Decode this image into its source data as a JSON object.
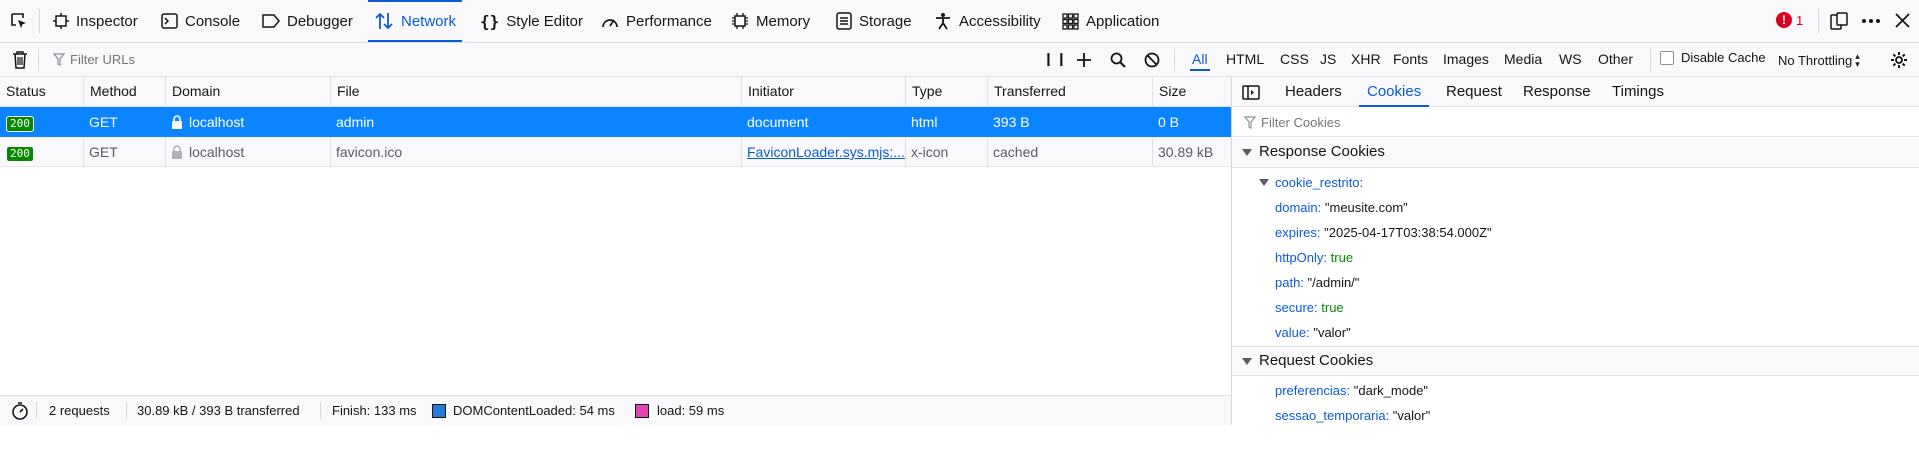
{
  "toolbar": {
    "tabs": [
      {
        "label": "Inspector",
        "icon": "inspector-icon"
      },
      {
        "label": "Console",
        "icon": "console-icon"
      },
      {
        "label": "Debugger",
        "icon": "debugger-icon"
      },
      {
        "label": "Network",
        "icon": "network-icon",
        "active": true
      },
      {
        "label": "Style Editor",
        "icon": "style-editor-icon"
      },
      {
        "label": "Performance",
        "icon": "performance-icon"
      },
      {
        "label": "Memory",
        "icon": "memory-icon"
      },
      {
        "label": "Storage",
        "icon": "storage-icon"
      },
      {
        "label": "Accessibility",
        "icon": "accessibility-icon"
      },
      {
        "label": "Application",
        "icon": "application-icon"
      }
    ],
    "error_count": "1",
    "colors": {
      "accent": "#0a5bd6",
      "error": "#d70022"
    }
  },
  "filterbar": {
    "placeholder": "Filter URLs",
    "types": [
      "All",
      "HTML",
      "CSS",
      "JS",
      "XHR",
      "Fonts",
      "Images",
      "Media",
      "WS",
      "Other"
    ],
    "active_type": "All",
    "disable_cache_label": "Disable Cache",
    "throttling": "No Throttling"
  },
  "table": {
    "columns": [
      "Status",
      "Method",
      "Domain",
      "File",
      "Initiator",
      "Type",
      "Transferred",
      "Size"
    ],
    "rows": [
      {
        "status": "200",
        "method": "GET",
        "domain": "localhost",
        "file": "admin",
        "initiator": "document",
        "type": "html",
        "transferred": "393 B",
        "size": "0 B"
      },
      {
        "status": "200",
        "method": "GET",
        "domain": "localhost",
        "file": "favicon.ico",
        "initiator": "FaviconLoader.sys.mjs:...",
        "type": "x-icon",
        "transferred": "cached",
        "size": "30.89 kB"
      }
    ]
  },
  "statusbar": {
    "requests": "2 requests",
    "transferred": "30.89 kB / 393 B transferred",
    "finish": "Finish: 133 ms",
    "dcl": "DOMContentLoaded: 54 ms",
    "load": "load: 59 ms",
    "colors": {
      "dcl": "#2a7bd8",
      "load": "#e046b0"
    }
  },
  "panel": {
    "tabs": [
      "Headers",
      "Cookies",
      "Request",
      "Response",
      "Timings"
    ],
    "active_tab": "Cookies",
    "filter_placeholder": "Filter Cookies",
    "response_section": "Response Cookies",
    "cookie_name": "cookie_restrito:",
    "cookie_props": [
      {
        "key": "domain:",
        "value": "\"meusite.com\"",
        "kind": "str"
      },
      {
        "key": "expires:",
        "value": "\"2025-04-17T03:38:54.000Z\"",
        "kind": "str"
      },
      {
        "key": "httpOnly:",
        "value": "true",
        "kind": "bool"
      },
      {
        "key": "path:",
        "value": "\"/admin/\"",
        "kind": "str"
      },
      {
        "key": "secure:",
        "value": "true",
        "kind": "bool"
      },
      {
        "key": "value:",
        "value": "\"valor\"",
        "kind": "str"
      }
    ],
    "request_section": "Request Cookies",
    "request_cookies": [
      {
        "key": "preferencias:",
        "value": "\"dark_mode\""
      },
      {
        "key": "sessao_temporaria:",
        "value": "\"valor\""
      }
    ]
  }
}
